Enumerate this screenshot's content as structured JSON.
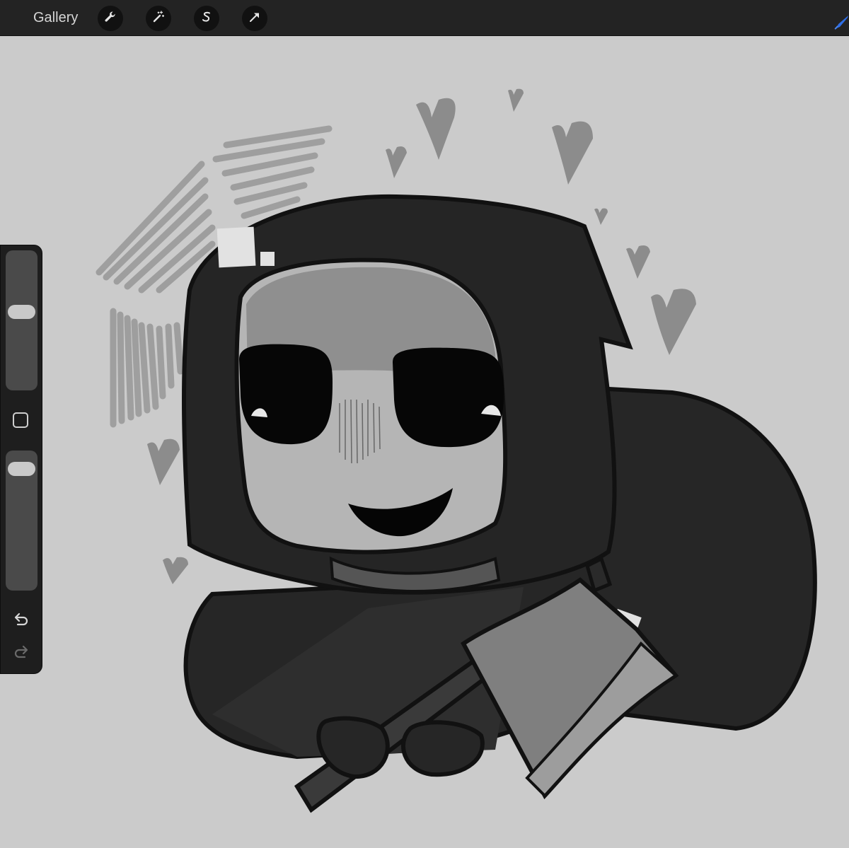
{
  "toolbar": {
    "gallery_label": "Gallery",
    "tools": [
      {
        "icon": "wrench-icon"
      },
      {
        "icon": "magic-wand-icon"
      },
      {
        "icon": "selection-s-icon"
      },
      {
        "icon": "arrow-transform-icon"
      }
    ],
    "brush_color": "#2f6ee6"
  },
  "sidebar": {
    "brush_size_level": 0.57,
    "opacity_level": 0.07
  },
  "colors": {
    "topbar": "#232323",
    "canvas": "#cbcbcb",
    "sidebar": "#1e1e1e"
  }
}
